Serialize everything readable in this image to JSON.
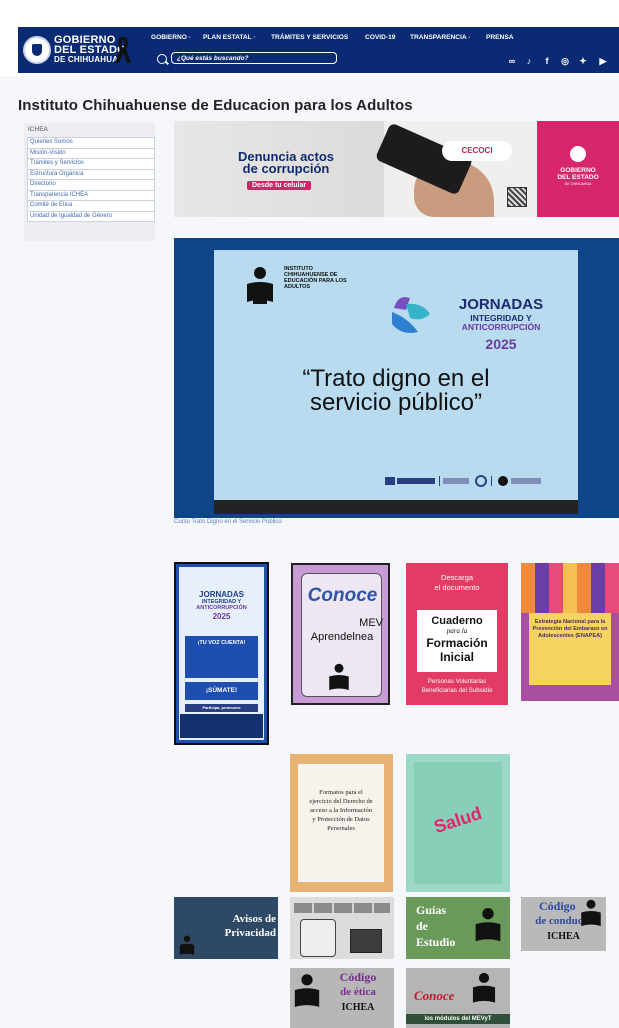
{
  "header": {
    "logo_line1": "GOBIERNO",
    "logo_line2": "DEL ESTADO",
    "logo_line3": "DE CHIHUAHUA",
    "nav": [
      {
        "label": "GOBIERNO ·"
      },
      {
        "label": "PLAN ESTATAL ·"
      },
      {
        "label": "TRÁMITES Y SERVICIOS"
      },
      {
        "label": "COVID-19"
      },
      {
        "label": "TRANSPARENCIA ·"
      },
      {
        "label": "PRENSA"
      }
    ],
    "search_placeholder": "¿Qué estás buscando?",
    "social": [
      "link-icon",
      "tiktok-icon",
      "facebook-icon",
      "instagram-icon",
      "twitter-icon",
      "youtube-icon"
    ]
  },
  "page_title": "Instituto Chihuahuense de Educacion para los Adultos",
  "sidebar": {
    "header": "ICHEA",
    "items": [
      {
        "label": "Quienes Somos"
      },
      {
        "label": "Misión-Visión"
      },
      {
        "label": "Trámites y Servicios"
      },
      {
        "label": "Estructura Orgánica"
      },
      {
        "label": "Directorio"
      },
      {
        "label": "Transparencia ICHEA"
      },
      {
        "label": "Comité de Ética"
      },
      {
        "label": "Unidad de Igualdad de Género"
      }
    ]
  },
  "banner": {
    "headline_1": "Denuncia actos",
    "headline_2": "de corrupción",
    "cta": "Desde tu celular",
    "cecoci": "CECOCI",
    "right_1": "GOBIERNO",
    "right_2": "DEL ESTADO",
    "right_3": "DE CHIHUAHUA"
  },
  "video": {
    "inst_line1": "INSTITUTO",
    "inst_line2": "CHIHUAHUENSE DE",
    "inst_line3": "EDUCACIÓN PARA LOS",
    "inst_line4": "ADULTOS",
    "jornadas_1": "JORNADAS",
    "jornadas_2": "INTEGRIDAD Y",
    "jornadas_3": "ANTICORRUPCIÓN",
    "year": "2025",
    "quote_1": "“Trato digno en el",
    "quote_2": "servicio público”",
    "caption": "Curso Trato Digno en el Servicio Público"
  },
  "tiles": {
    "jornadas": {
      "t1": "JORNADAS",
      "t2": "INTEGRIDAD Y",
      "t3": "ANTICORRUPCIÓN",
      "year": "2025",
      "vote": "¡TU VOZ CUENTA!",
      "participa": "Participa, promueve",
      "sumate": "¡SÚMATE!"
    },
    "mev": {
      "conoce": "Conoce",
      "mev": "MEV",
      "aprende": "Aprendelnea"
    },
    "cuaderno": {
      "top1": "Descarga",
      "top2": "el documento",
      "c1": "Cuaderno",
      "c2": "para la",
      "c3": "Formación",
      "c4": "Inicial",
      "b1": "Personas Voluntarias",
      "b2": "Beneficiarias del Subsidio"
    },
    "estrategia": {
      "text": "Estrategia Nacional para la Prevención del Embarazo en Adolescentes (ENAPEA)"
    },
    "formatos": {
      "text": "Formatos para el ejercicio del Derecho de acceso a la Información y Protección de Datos Personales"
    },
    "salud": {
      "text": "Salud"
    },
    "avisos": {
      "l1": "Avisos de",
      "l2": "Privacidad"
    },
    "guias": {
      "l1": "Guías",
      "l2": "de",
      "l3": "Estudio"
    },
    "codigo_conducta": {
      "l1": "Código",
      "l2": "de conducta",
      "l3": "ICHEA"
    },
    "codigo_etica": {
      "l1": "Código",
      "l2": "de ética",
      "l3": "ICHEA"
    },
    "conoce_modulos": {
      "l1": "Conoce",
      "l2": "los módulos del MEVyT"
    }
  }
}
